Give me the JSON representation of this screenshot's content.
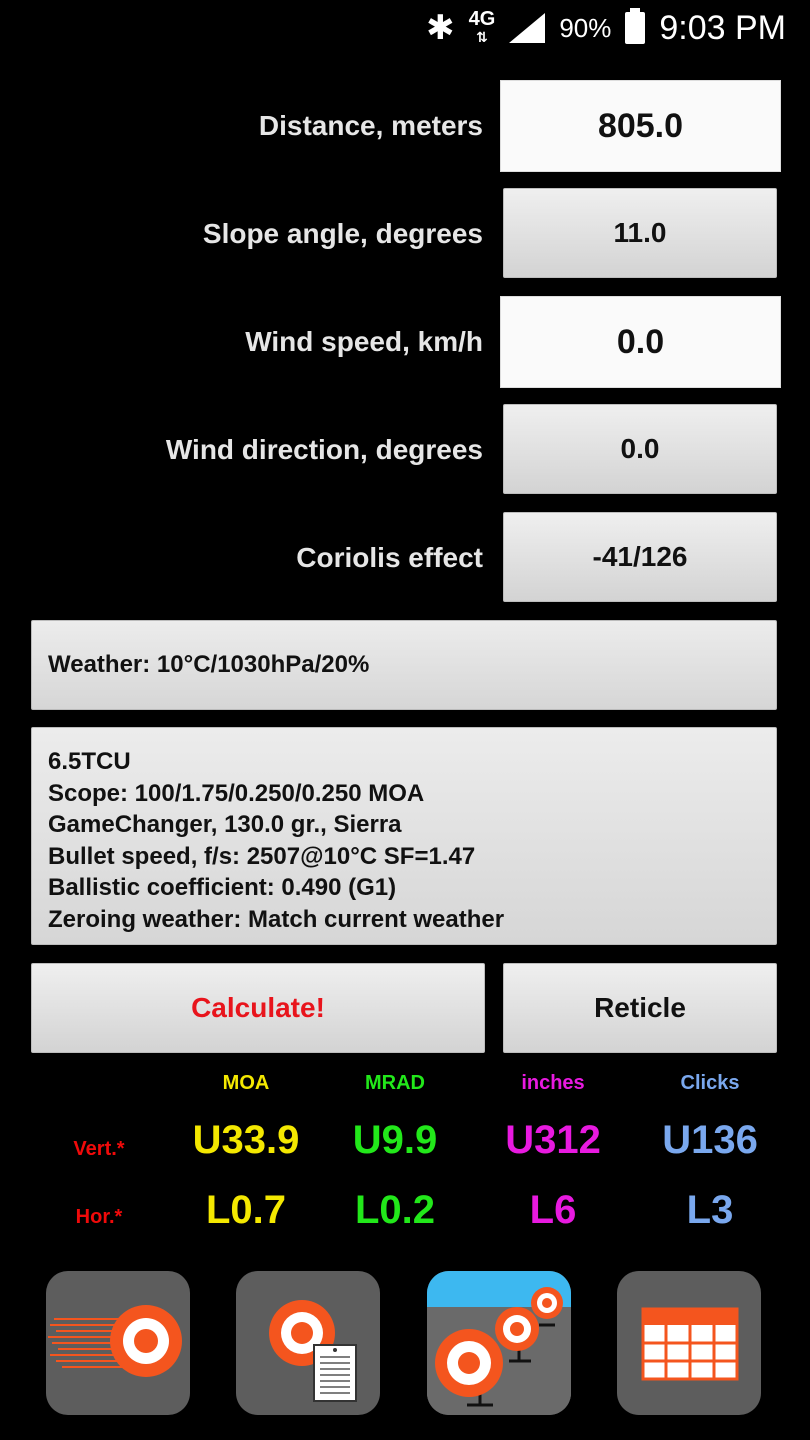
{
  "status_bar": {
    "bluetooth_icon": "bluetooth-icon",
    "network": "4G",
    "battery": "90%",
    "time": "9:03 PM"
  },
  "inputs": {
    "distance": {
      "label": "Distance, meters",
      "value": "805.0"
    },
    "slope": {
      "label": "Slope angle, degrees",
      "value": "11.0"
    },
    "wind_speed": {
      "label": "Wind speed, km/h",
      "value": "0.0"
    },
    "wind_direction": {
      "label": "Wind direction, degrees",
      "value": "0.0"
    },
    "coriolis": {
      "label": "Coriolis effect",
      "value": "-41/126"
    }
  },
  "weather": "Weather: 10°C/1030hPa/20%",
  "profile": {
    "lines": [
      "6.5TCU",
      "Scope: 100/1.75/0.250/0.250 MOA",
      "GameChanger, 130.0 gr., Sierra",
      "Bullet speed, f/s: 2507@10°C SF=1.47",
      "Ballistic coefficient: 0.490 (G1)",
      "Zeroing weather: Match current weather"
    ]
  },
  "buttons": {
    "calculate": "Calculate!",
    "reticle": "Reticle"
  },
  "results": {
    "headers": [
      "MOA",
      "MRAD",
      "inches",
      "Clicks"
    ],
    "vert_label": "Vert.*",
    "hor_label": "Hor.*",
    "vert": [
      "U33.9",
      "U9.9",
      "U312",
      "U136"
    ],
    "hor": [
      "L0.7",
      "L0.2",
      "L6",
      "L3"
    ]
  },
  "colors": {
    "moa": "#f4e800",
    "mrad": "#22e81a",
    "inches": "#e81ae0",
    "clicks": "#7aa8ee",
    "calculate": "#e8141c",
    "accent": "#f4551e"
  },
  "bottom_nav": {
    "icons": [
      "fast-target-icon",
      "target-notes-icon",
      "range-targets-icon",
      "table-icon"
    ]
  }
}
